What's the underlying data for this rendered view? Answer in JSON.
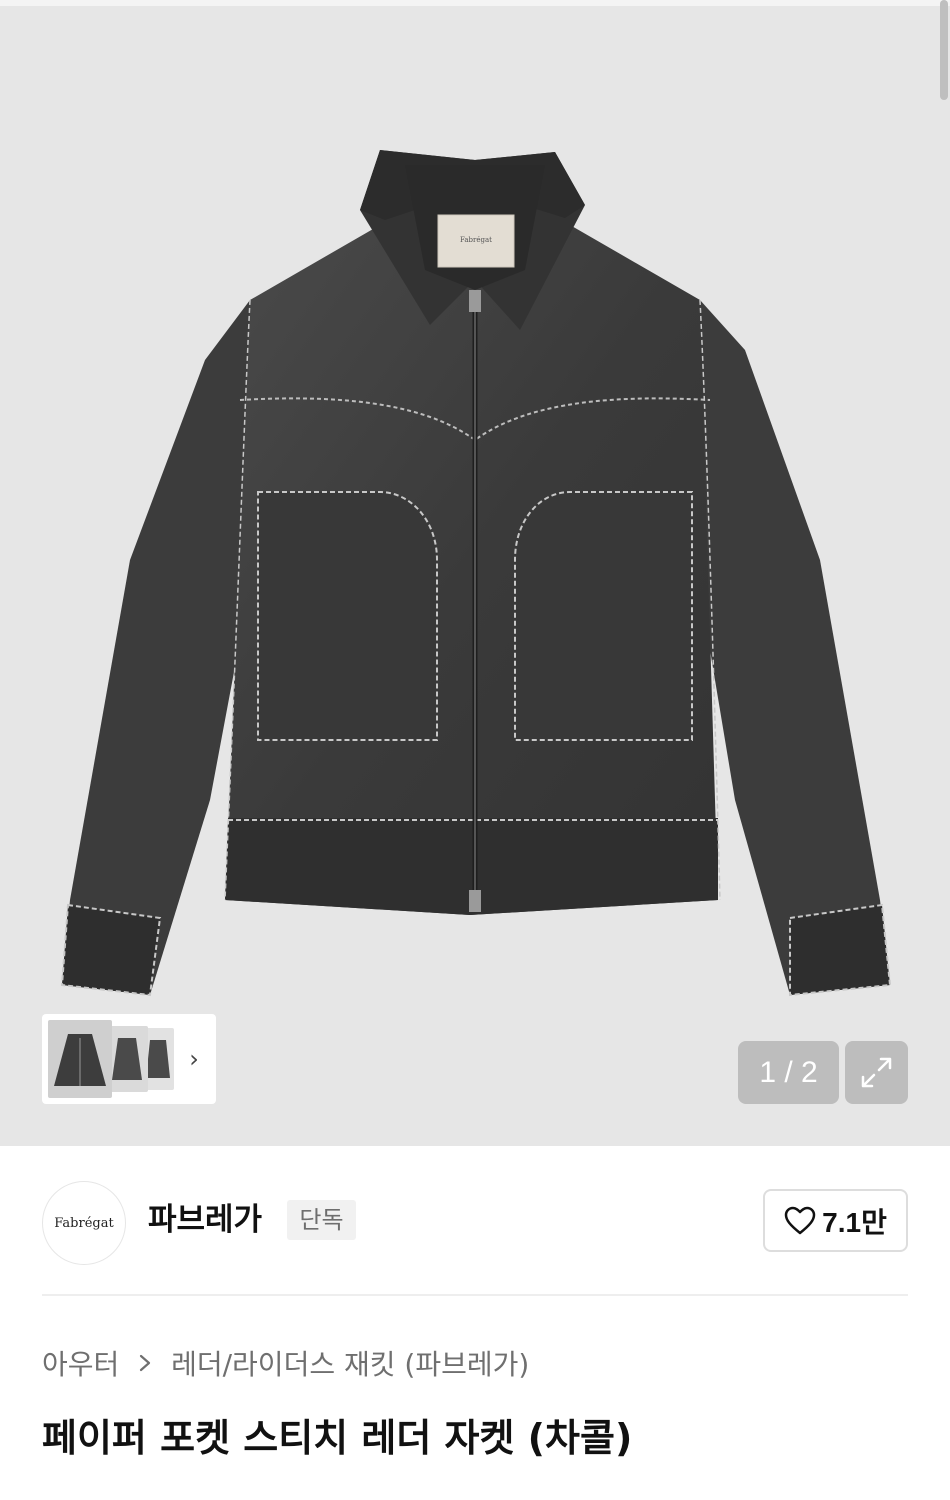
{
  "gallery": {
    "current_page": 1,
    "total_pages": 2,
    "counter_text": "1 / 2",
    "expand_icon": "expand-icon",
    "next_icon": "chevron-right-icon",
    "label_text": "Fabrégat"
  },
  "brand": {
    "logo_text": "Fabrégat",
    "name": "파브레가",
    "badge": "단독"
  },
  "like": {
    "icon": "heart-icon",
    "count": "7.1만"
  },
  "breadcrumb": {
    "category": "아우터",
    "separator_icon": "chevron-right-icon",
    "subcategory": "레더/라이더스 재킷 (파브레가)"
  },
  "product": {
    "title": "페이퍼 포켓 스티치 레더 자켓 (차콜)"
  }
}
